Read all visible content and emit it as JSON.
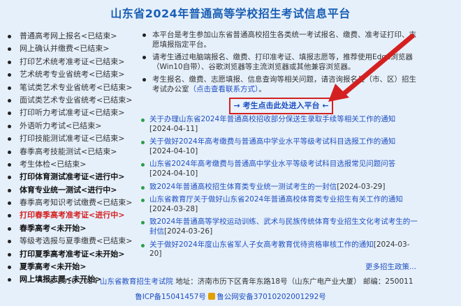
{
  "title": "山东省2024年普通高等学校招生考试信息平台",
  "left_items": [
    {
      "text": "普通高考网上报名<已结束>",
      "style": "normal"
    },
    {
      "text": "网上确认并缴费<已结束>",
      "style": "normal"
    },
    {
      "text": "打印艺术统考准考证<已结束>",
      "style": "normal"
    },
    {
      "text": "艺术统考专业省统考<已结束>",
      "style": "normal"
    },
    {
      "text": "笔试类艺术专业省统考<已结束>",
      "style": "normal"
    },
    {
      "text": "面试类艺术专业省统考<已结束>",
      "style": "normal"
    },
    {
      "text": "打印听力考试准考证<已结束>",
      "style": "normal"
    },
    {
      "text": "外语听力考试<已结束>",
      "style": "normal"
    },
    {
      "text": "打印技能测试准考证<已结束>",
      "style": "normal"
    },
    {
      "text": "春季高考技能测试<已结束>",
      "style": "normal"
    },
    {
      "text": "考生体检<已结束>",
      "style": "normal"
    },
    {
      "text": "打印体育测试准考证<进行中>",
      "style": "bold"
    },
    {
      "text": "体育专业统一测试<进行中>",
      "style": "bold"
    },
    {
      "text": "春季高考知识考试缴费<已结束>",
      "style": "normal"
    },
    {
      "text": "打印春季高考准考证<进行中>",
      "style": "red"
    },
    {
      "text": "春季高考<未开始>",
      "style": "bold"
    },
    {
      "text": "等级考选报与夏季缴费<已结束>",
      "style": "normal"
    },
    {
      "text": "打印夏季高考准考证<未开始>",
      "style": "bold"
    },
    {
      "text": "夏季高考<未开始>",
      "style": "bold"
    },
    {
      "text": "网上填报志愿<未开始>",
      "style": "bold"
    }
  ],
  "info": {
    "item1": "本平台是考生参加山东省普通高校招生各类统一考试报名、缴费、准考证打印、志愿填报指定平台。",
    "item2": "请考生通过电脑端报名、缴费、打印准考证、填报志愿等，推荐使用Edge浏览器（Win10自带）、谷歌浏览器等主流浏览器或其他兼容浏览器。",
    "item3_text": "考生报名、缴费、志愿填报、信息查询等相关问题，请咨询报名县（市、区）招生考试办公室",
    "item3_link": "（点击查看联系方式）",
    "item3_end": "。"
  },
  "enter_button": "→ 考生点击此处进入平台 ←",
  "notices": [
    {
      "title": "关于办理山东省2024年普通高校招收部分保送生录取手续等相关工作的通知",
      "date": "[2024-04-11]"
    },
    {
      "title": "关于做好2024年高考缴费与普通高中学业水平等级考试科目选报工作的通知",
      "date": "[2024-04-10]"
    },
    {
      "title": "山东省2024年高考缴费与普通高中学业水平等级考试科目选报常见问题问答",
      "date": "[2024-04-10]"
    },
    {
      "title": "致2024年普通高校招生体育类专业统一测试考生的一封信",
      "date": "[2024-03-29]"
    },
    {
      "title": "山东省教育厅关于做好山东省2024年普通高校体育类专业招生有关工作的通知",
      "date": "[2024-03-28]"
    },
    {
      "title": "致2024年普通高等学校运动训练、武术与民族传统体育专业招生文化考试考生的一封信",
      "date": "[2024-03-26]"
    },
    {
      "title": "关于做好2024年度山东省军人子女高考教育优待资格审核工作的通知",
      "date": "[2024-03-20]"
    }
  ],
  "more_link": "更多招生政策...",
  "footer": {
    "copyright": "© 2010-2024",
    "org_link": "山东省教育招生考试院",
    "address": "地址：济南市历下区青年东路18号（山东广电产业大厦）  邮编：250011",
    "icp": "鲁ICP备15041457号",
    "police": "鲁公网安备37010202001292号"
  },
  "colors": {
    "title": "#1a5fb4",
    "link": "#2050c0",
    "highlight": "#d42020",
    "background": "#e6f0fb"
  }
}
